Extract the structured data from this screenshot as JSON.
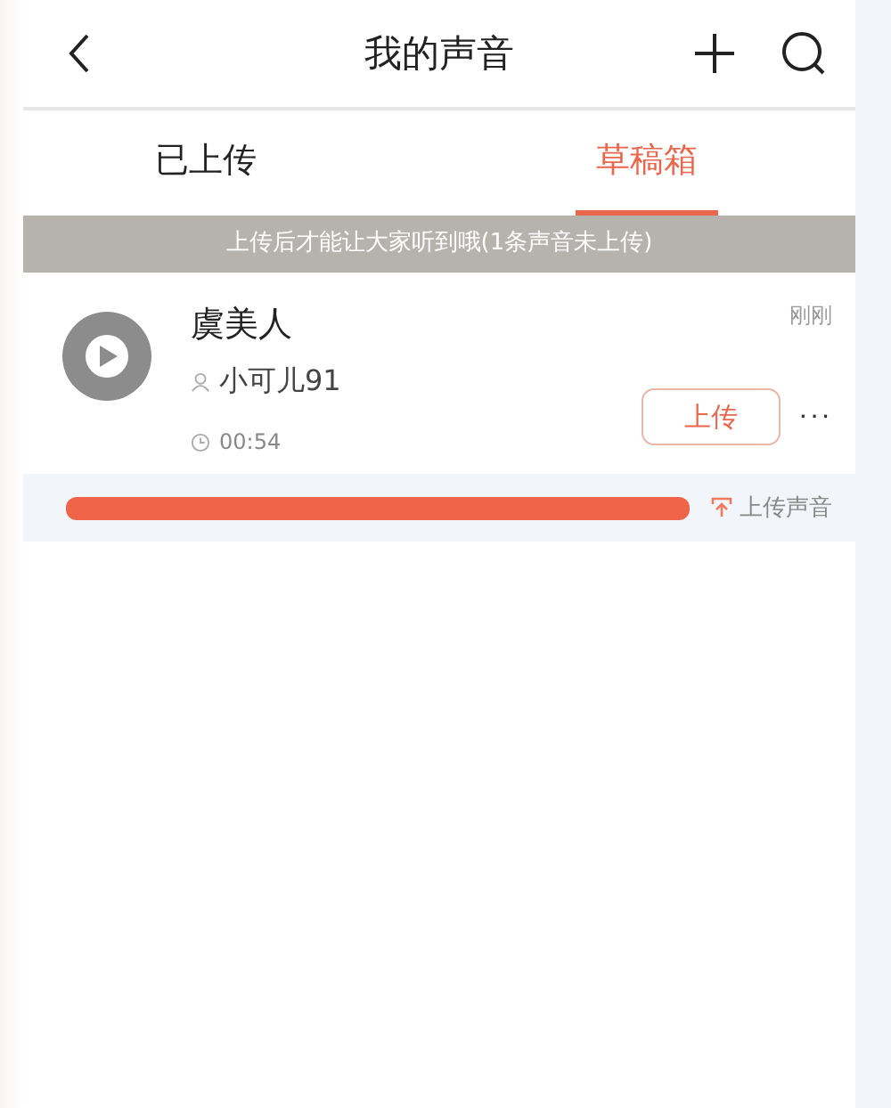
{
  "header": {
    "title": "我的声音"
  },
  "tabs": [
    {
      "label": "已上传",
      "selected": false
    },
    {
      "label": "草稿箱",
      "selected": true
    }
  ],
  "notice": "上传后才能让大家听到哦(1条声音未上传)",
  "drafts": [
    {
      "title": "虞美人",
      "author": "小可儿91",
      "duration": "00:54",
      "time": "刚刚",
      "upload_button": "上传",
      "more": "···",
      "progress": {
        "label": "上传声音"
      }
    }
  ]
}
